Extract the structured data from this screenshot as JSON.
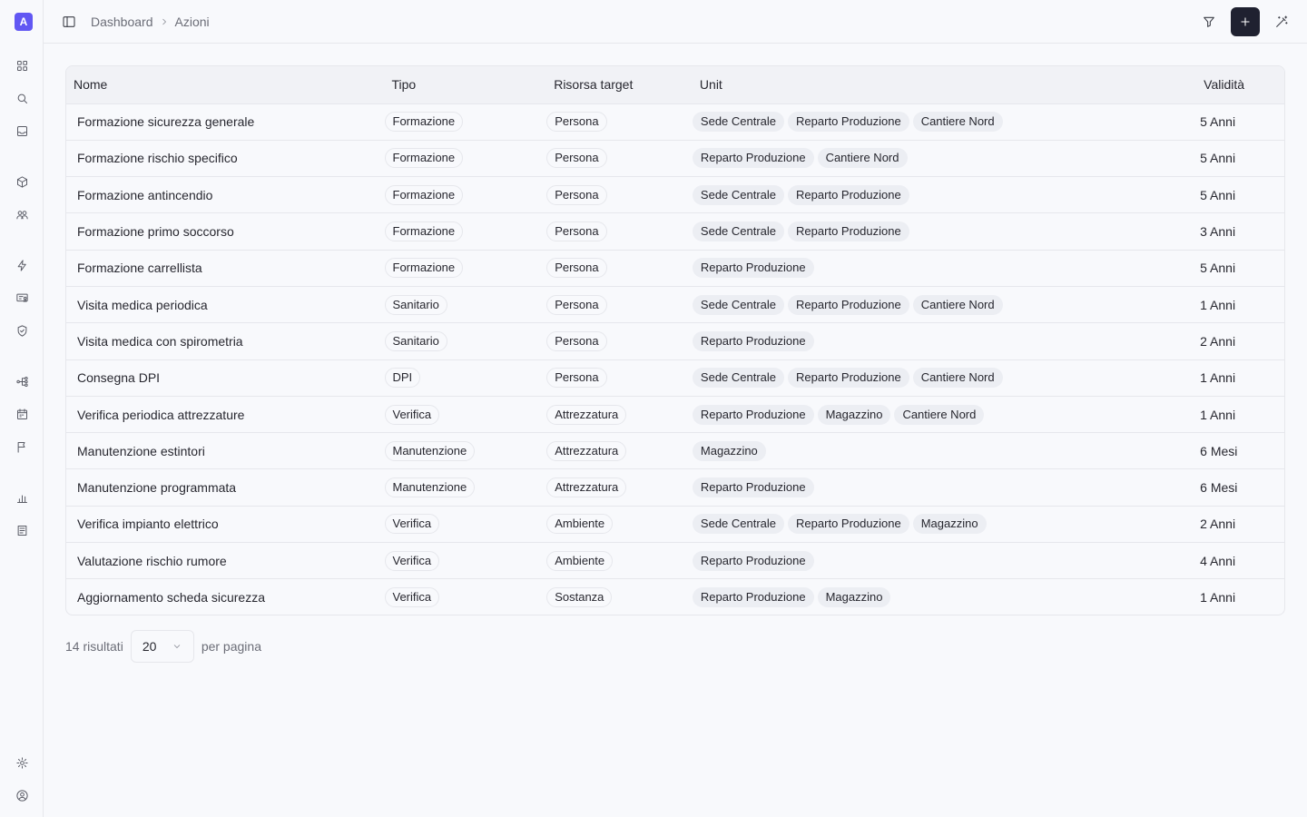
{
  "app": {
    "logo_letter": "A",
    "accent": "#6157f3"
  },
  "sidebar": {
    "icons": [
      "grid-icon",
      "search-icon",
      "inbox-icon",
      "box-icon",
      "users-icon",
      "bolt-icon",
      "certificate-icon",
      "shield-icon",
      "hierarchy-icon",
      "calendar-icon",
      "flag-icon",
      "bar-chart-icon",
      "list-icon",
      "settings-icon",
      "user-circle-icon"
    ]
  },
  "header": {
    "breadcrumb": [
      "Dashboard",
      "Azioni"
    ]
  },
  "table": {
    "columns": [
      "Nome",
      "Tipo",
      "Risorsa target",
      "Unit",
      "Validità"
    ],
    "rows": [
      {
        "nome": "Formazione sicurezza generale",
        "tipo": "Formazione",
        "risorsa": "Persona",
        "units": [
          "Sede Centrale",
          "Reparto Produzione",
          "Cantiere Nord"
        ],
        "validita": "5 Anni"
      },
      {
        "nome": "Formazione rischio specifico",
        "tipo": "Formazione",
        "risorsa": "Persona",
        "units": [
          "Reparto Produzione",
          "Cantiere Nord"
        ],
        "validita": "5 Anni"
      },
      {
        "nome": "Formazione antincendio",
        "tipo": "Formazione",
        "risorsa": "Persona",
        "units": [
          "Sede Centrale",
          "Reparto Produzione"
        ],
        "validita": "5 Anni"
      },
      {
        "nome": "Formazione primo soccorso",
        "tipo": "Formazione",
        "risorsa": "Persona",
        "units": [
          "Sede Centrale",
          "Reparto Produzione"
        ],
        "validita": "3 Anni"
      },
      {
        "nome": "Formazione carrellista",
        "tipo": "Formazione",
        "risorsa": "Persona",
        "units": [
          "Reparto Produzione"
        ],
        "validita": "5 Anni"
      },
      {
        "nome": "Visita medica periodica",
        "tipo": "Sanitario",
        "risorsa": "Persona",
        "units": [
          "Sede Centrale",
          "Reparto Produzione",
          "Cantiere Nord"
        ],
        "validita": "1 Anni"
      },
      {
        "nome": "Visita medica con spirometria",
        "tipo": "Sanitario",
        "risorsa": "Persona",
        "units": [
          "Reparto Produzione"
        ],
        "validita": "2 Anni"
      },
      {
        "nome": "Consegna DPI",
        "tipo": "DPI",
        "risorsa": "Persona",
        "units": [
          "Sede Centrale",
          "Reparto Produzione",
          "Cantiere Nord"
        ],
        "validita": "1 Anni"
      },
      {
        "nome": "Verifica periodica attrezzature",
        "tipo": "Verifica",
        "risorsa": "Attrezzatura",
        "units": [
          "Reparto Produzione",
          "Magazzino",
          "Cantiere Nord"
        ],
        "validita": "1 Anni"
      },
      {
        "nome": "Manutenzione estintori",
        "tipo": "Manutenzione",
        "risorsa": "Attrezzatura",
        "units": [
          "Magazzino"
        ],
        "validita": "6 Mesi"
      },
      {
        "nome": "Manutenzione programmata",
        "tipo": "Manutenzione",
        "risorsa": "Attrezzatura",
        "units": [
          "Reparto Produzione"
        ],
        "validita": "6 Mesi"
      },
      {
        "nome": "Verifica impianto elettrico",
        "tipo": "Verifica",
        "risorsa": "Ambiente",
        "units": [
          "Sede Centrale",
          "Reparto Produzione",
          "Magazzino"
        ],
        "validita": "2 Anni"
      },
      {
        "nome": "Valutazione rischio rumore",
        "tipo": "Verifica",
        "risorsa": "Ambiente",
        "units": [
          "Reparto Produzione"
        ],
        "validita": "4 Anni"
      },
      {
        "nome": "Aggiornamento scheda sicurezza",
        "tipo": "Verifica",
        "risorsa": "Sostanza",
        "units": [
          "Reparto Produzione",
          "Magazzino"
        ],
        "validita": "1 Anni"
      }
    ]
  },
  "footer": {
    "results": "14 risultati",
    "page_size": "20",
    "per_page": "per pagina"
  }
}
